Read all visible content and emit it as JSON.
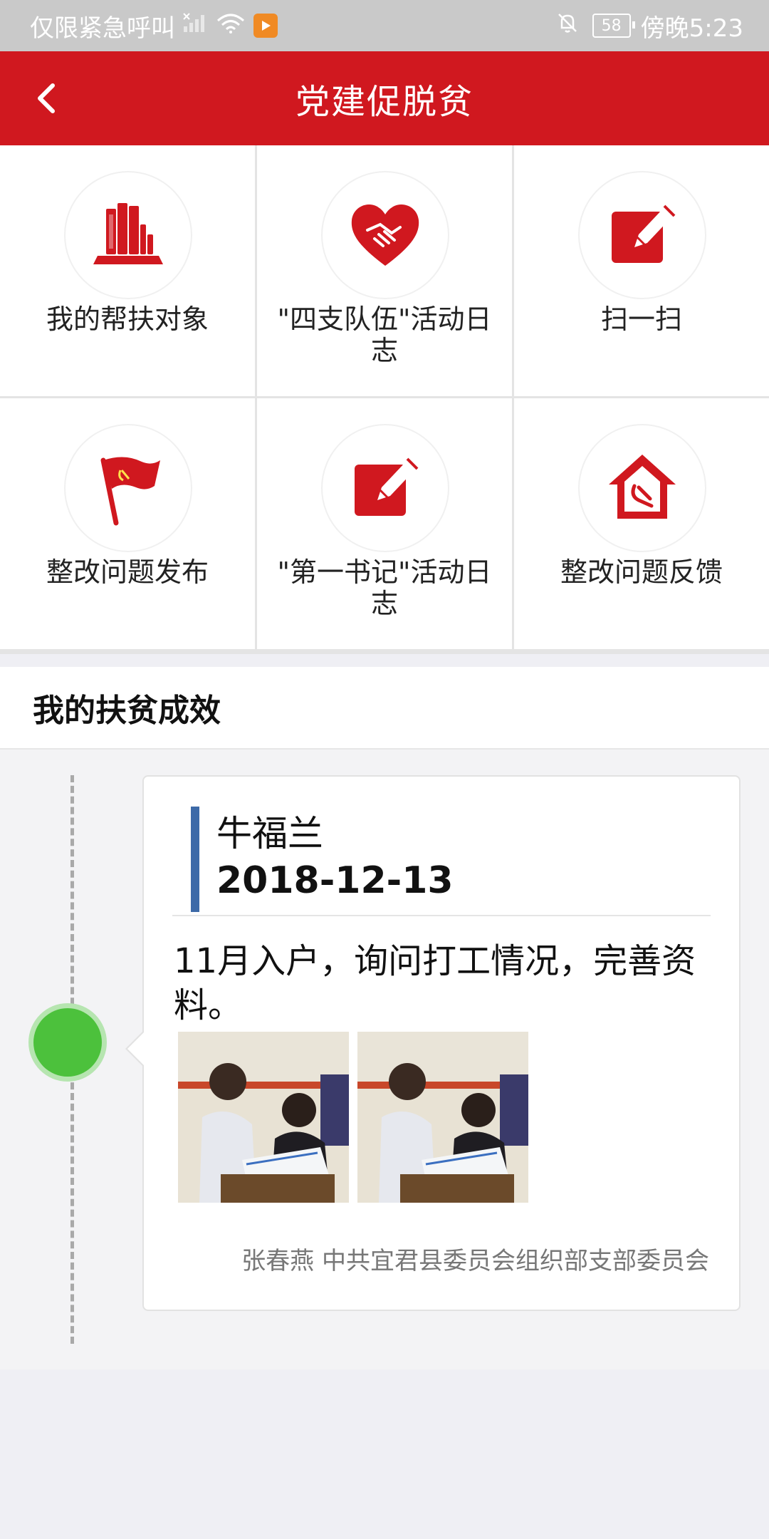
{
  "status_bar": {
    "carrier": "仅限紧急呼叫",
    "battery": "58",
    "time": "傍晚5:23"
  },
  "header": {
    "title": "党建促脱贫"
  },
  "grid": {
    "items": [
      {
        "label": "我的帮扶对象",
        "icon": "books-icon"
      },
      {
        "label": "\"四支队伍\"活动日志",
        "icon": "heart-handshake-icon"
      },
      {
        "label": "扫一扫",
        "icon": "edit-icon"
      },
      {
        "label": "整改问题发布",
        "icon": "party-flag-icon"
      },
      {
        "label": "\"第一书记\"活动日志",
        "icon": "edit-icon"
      },
      {
        "label": "整改问题反馈",
        "icon": "party-house-icon"
      }
    ]
  },
  "section": {
    "title": "我的扶贫成效"
  },
  "timeline": {
    "entries": [
      {
        "name": "牛福兰",
        "date": "2018-12-13",
        "description": "11月入户，询问打工情况，完善资料。",
        "author": "张春燕 中共宜君县委员会组织部支部委员会",
        "photo_count": 2
      }
    ]
  },
  "colors": {
    "brand_red": "#d0181f",
    "accent_blue": "#3d6aa8",
    "timeline_green": "#4cc13c"
  }
}
